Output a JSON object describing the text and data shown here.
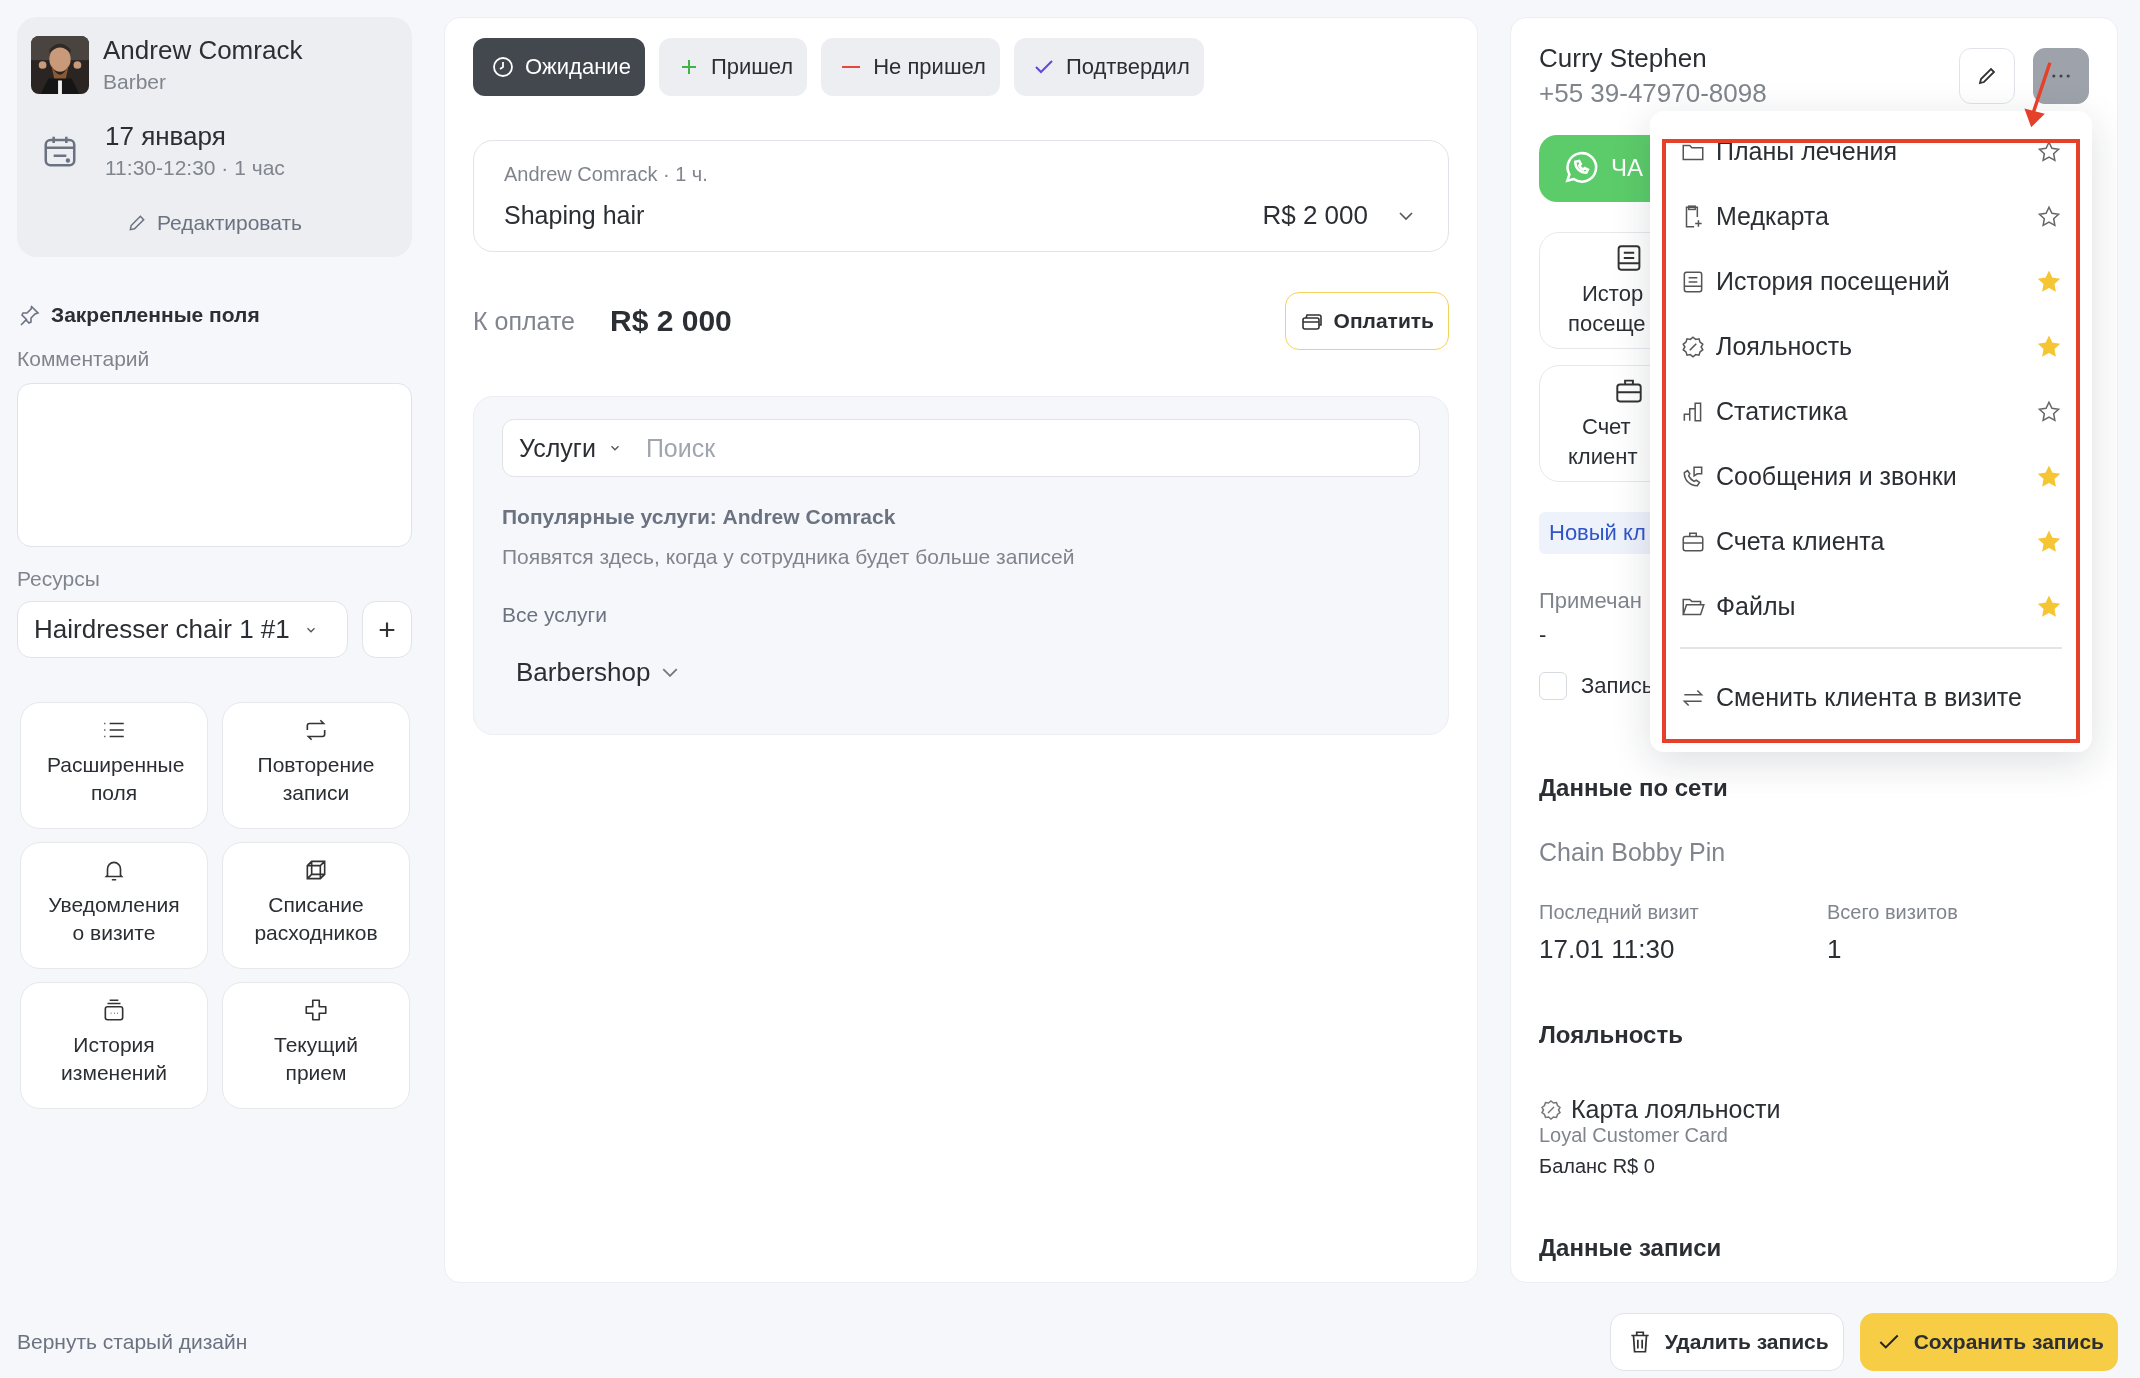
{
  "staff": {
    "name": "Andrew Comrack",
    "role": "Barber"
  },
  "appointment": {
    "date": "17 января",
    "time": "11:30-12:30 · 1 час",
    "edit": "Редактировать"
  },
  "pinned": {
    "title": "Закрепленные поля",
    "comment_label": "Комментарий",
    "resources_label": "Ресурсы",
    "resource": "Hairdresser chair 1 #1",
    "add": "+"
  },
  "actions": [
    {
      "label": "Расширенные поля"
    },
    {
      "label": "Повторение записи"
    },
    {
      "label": "Уведомления о визите"
    },
    {
      "label": "Списание расходников"
    },
    {
      "label": "История изменений"
    },
    {
      "label": "Текущий прием"
    }
  ],
  "footer_link": "Вернуть старый дизайн",
  "statuses": [
    {
      "label": "Ожидание",
      "selected": true
    },
    {
      "label": "Пришел",
      "selected": false
    },
    {
      "label": "Не пришел",
      "selected": false
    },
    {
      "label": "Подтвердил",
      "selected": false
    }
  ],
  "service": {
    "meta": "Andrew Comrack · 1 ч.",
    "name": "Shaping hair",
    "price": "R$ 2 000"
  },
  "payment": {
    "label": "К оплате",
    "amount": "R$ 2 000",
    "button": "Оплатить"
  },
  "catalog": {
    "category": "Услуги",
    "placeholder": "Поиск",
    "popular_title": "Популярные услуги: Andrew Comrack",
    "popular_hint": "Появятся здесь, когда у сотрудника будет больше записей",
    "all_title": "Все услуги",
    "group": "Barbershop"
  },
  "client": {
    "name": "Curry Stephen",
    "phone": "+55 39-47970-8098",
    "chat": "ЧА",
    "cards": [
      {
        "lines": [
          "Истор",
          "посеще"
        ]
      },
      {
        "lines": [
          "Счет",
          "клиент"
        ]
      }
    ],
    "badge": "Новый кл",
    "note_label": "Примечан",
    "note": "-",
    "checkbox": {
      "label": "Запись",
      "checked": false
    }
  },
  "network": {
    "title": "Данные по сети",
    "chain": "Chain Bobby Pin",
    "last_visit_label": "Последний визит",
    "last_visit": "17.01 11:30",
    "total_label": "Всего визитов",
    "total": "1"
  },
  "loyalty": {
    "title": "Лояльность",
    "card": "Карта лояльности",
    "card_name": "Loyal Customer Card",
    "balance": "Баланс R$ 0"
  },
  "record_title": "Данные записи",
  "menu": {
    "items": [
      {
        "label": "Планы лечения",
        "favorite": false
      },
      {
        "label": "Медкарта",
        "favorite": false
      },
      {
        "label": "История посещений",
        "favorite": true
      },
      {
        "label": "Лояльность",
        "favorite": true
      },
      {
        "label": "Статистика",
        "favorite": false
      },
      {
        "label": "Сообщения и звонки",
        "favorite": true
      },
      {
        "label": "Счета клиента",
        "favorite": true
      },
      {
        "label": "Файлы",
        "favorite": true
      }
    ],
    "switch_client": "Сменить клиента в визите"
  },
  "buttons": {
    "delete": "Удалить запись",
    "save": "Сохранить запись"
  }
}
